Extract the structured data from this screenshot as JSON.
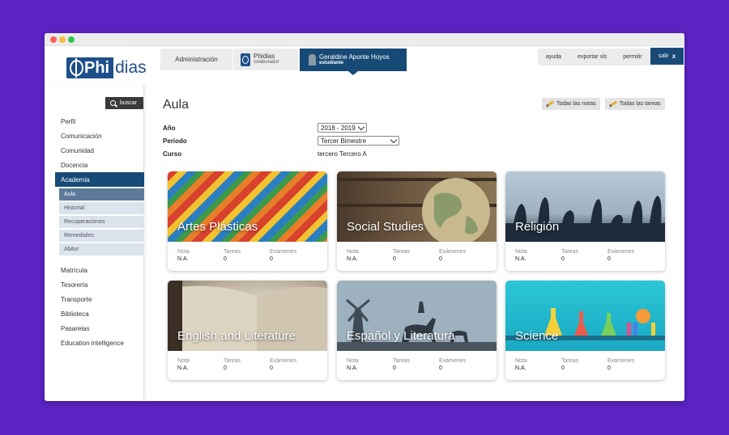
{
  "brand": {
    "logo_letters": "Phi",
    "logo_rest": "dias"
  },
  "header": {
    "tab_admin": "Administración",
    "tab_collab_title": "Phidias",
    "tab_collab_sub": "colaborador",
    "user_name": "Geraldine Aponte Hoyos",
    "user_role": "estudiante",
    "links": [
      "ayuda",
      "exportar xls",
      "permitir"
    ],
    "exit_label": "salir",
    "exit_glyph": "x"
  },
  "sidebar": {
    "search_label": "buscar",
    "items": [
      {
        "label": "Perfil"
      },
      {
        "label": "Comunicación"
      },
      {
        "label": "Comunidad"
      },
      {
        "label": "Docencia"
      },
      {
        "label": "Academia"
      }
    ],
    "subitems": [
      {
        "label": "Aula"
      },
      {
        "label": "Historial"
      },
      {
        "label": "Recuperaciones"
      },
      {
        "label": "Remediales"
      },
      {
        "label": "Abitur"
      }
    ],
    "items2": [
      {
        "label": "Matrícula"
      },
      {
        "label": "Tesorería"
      },
      {
        "label": "Transporte"
      },
      {
        "label": "Biblioteca"
      },
      {
        "label": "Pasarelas"
      },
      {
        "label": "Education intelligence"
      }
    ]
  },
  "main": {
    "title": "Aula",
    "btn_all_grades": "Todas las notas",
    "btn_all_tasks": "Todas las tareas",
    "year_label": "Año",
    "year_value": "2018 - 2019",
    "period_label": "Periodo",
    "period_value": "Tercer Bimestre",
    "course_label": "Curso",
    "course_value": "tercero Tercero A"
  },
  "stat_labels": {
    "grade": "Nota",
    "tasks": "Tareas",
    "exams": "Exámenes"
  },
  "cards": [
    {
      "title": "Artes Plásticas",
      "grade": "N.A.",
      "tasks": "0",
      "exams": "0"
    },
    {
      "title": "Social Studies",
      "grade": "N.A.",
      "tasks": "0",
      "exams": "0"
    },
    {
      "title": "Religión",
      "grade": "N.A.",
      "tasks": "0",
      "exams": "0"
    },
    {
      "title": "English and Literature",
      "grade": "N.A.",
      "tasks": "0",
      "exams": "0"
    },
    {
      "title": "Español y Literatura",
      "grade": "N.A.",
      "tasks": "0",
      "exams": "0"
    },
    {
      "title": "Science",
      "grade": "N.A.",
      "tasks": "0",
      "exams": "0"
    }
  ],
  "colors": {
    "background": "#5b23c2",
    "brand_blue": "#174a76",
    "active_sub": "#5d7a9b",
    "sub_bg": "#dbe3ec"
  }
}
